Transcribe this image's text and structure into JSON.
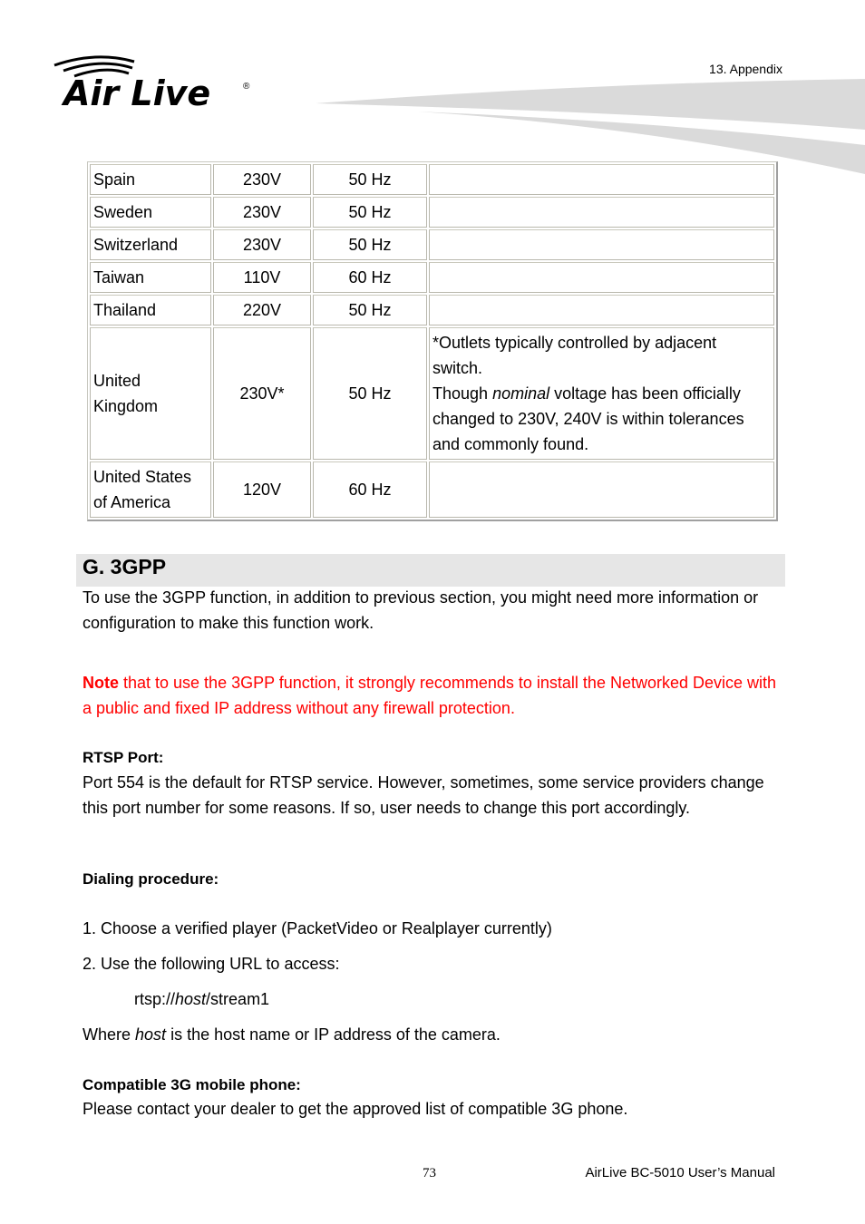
{
  "header": {
    "brand": "Air Live",
    "section": "13.  Appendix"
  },
  "table": {
    "rows": [
      {
        "country": "Spain",
        "voltage": "230V",
        "frequency": "50 Hz",
        "notes": ""
      },
      {
        "country": "Sweden",
        "voltage": "230V",
        "frequency": "50 Hz",
        "notes": ""
      },
      {
        "country": "Switzerland",
        "voltage": "230V",
        "frequency": "50 Hz",
        "notes": ""
      },
      {
        "country": "Taiwan",
        "voltage": "110V",
        "frequency": "60 Hz",
        "notes": ""
      },
      {
        "country": "Thailand",
        "voltage": "220V",
        "frequency": "50 Hz",
        "notes": ""
      },
      {
        "country_line1": "United",
        "country_line2": "Kingdom",
        "voltage": "230V*",
        "frequency": "50 Hz",
        "note_line1": "*Outlets typically controlled by adjacent switch.",
        "note_pre": "Though ",
        "note_em": "nominal",
        "note_post": " voltage has been officially changed to 230V, 240V is within tolerances and commonly found."
      },
      {
        "country_line1": "United States",
        "country_line2": "of America",
        "voltage": "120V",
        "frequency": "60 Hz",
        "notes": ""
      }
    ]
  },
  "section": {
    "title": "G. 3GPP",
    "intro": "To use the 3GPP function, in addition to previous section, you might need more information or configuration to make this function work.",
    "note_label": "Note",
    "note_text": " that to use the 3GPP function, it strongly recommends to install the Networked Device with a public and fixed IP address without any firewall protection.",
    "rtsp_heading": "RTSP Port:",
    "rtsp_text": "Port 554 is the default for RTSP service. However, sometimes, some service providers change this port number for some reasons. If so, user needs to change this port accordingly.",
    "dialing_heading": "Dialing procedure:",
    "step1": "1. Choose a verified player (PacketVideo or Realplayer currently)",
    "step2": "2. Use the following URL to access:",
    "url_pre": "rtsp://",
    "url_em": "host",
    "url_post": "/stream1",
    "where_pre": "Where ",
    "where_em": "host",
    "where_post": " is the host name or IP address of the camera.",
    "phone_heading": "Compatible 3G mobile phone:",
    "phone_text": "Please contact your dealer to get the approved list of compatible 3G phone."
  },
  "footer": {
    "page_number": "73",
    "manual_title": "AirLive  BC-5010  User’s  Manual"
  }
}
